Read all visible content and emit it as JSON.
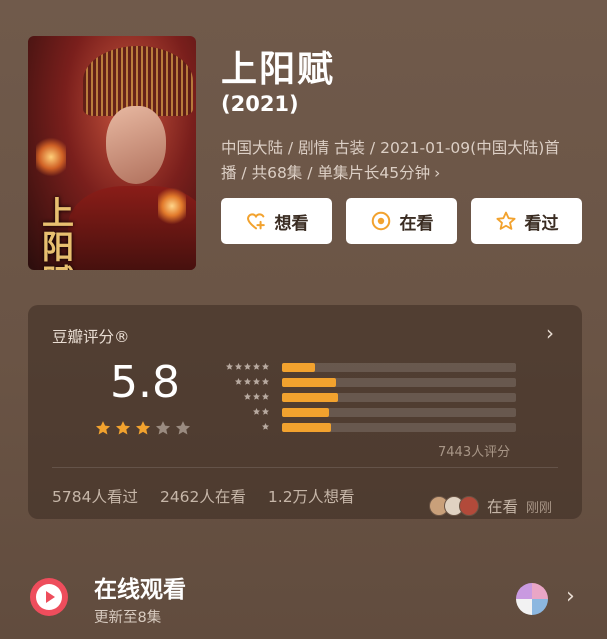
{
  "show": {
    "title": "上阳赋",
    "year": "(2021)",
    "meta": "中国大陆 / 剧情 古装 / 2021-01-09(中国大陆)首播 / 共68集 / 单集片长45分钟",
    "poster_title": "上阳赋"
  },
  "actions": {
    "want": "想看",
    "watching": "在看",
    "watched": "看过"
  },
  "rating": {
    "title": "豆瓣评分®",
    "score": "5.8",
    "stars": 3,
    "count": "7443人评分",
    "distribution": [
      {
        "stars": 5,
        "fraction": 0.14
      },
      {
        "stars": 4,
        "fraction": 0.23
      },
      {
        "stars": 3,
        "fraction": 0.24
      },
      {
        "stars": 2,
        "fraction": 0.2
      },
      {
        "stars": 1,
        "fraction": 0.21
      }
    ],
    "stats": [
      "5784人看过",
      "2462人在看",
      "1.2万人想看"
    ],
    "watching_now": "在看",
    "watching_time": "刚刚"
  },
  "online": {
    "title": "在线观看",
    "subtitle": "更新至8集"
  },
  "colors": {
    "accent": "#f2a22e",
    "play": "#ee4d5c",
    "background": "#6b5546"
  }
}
